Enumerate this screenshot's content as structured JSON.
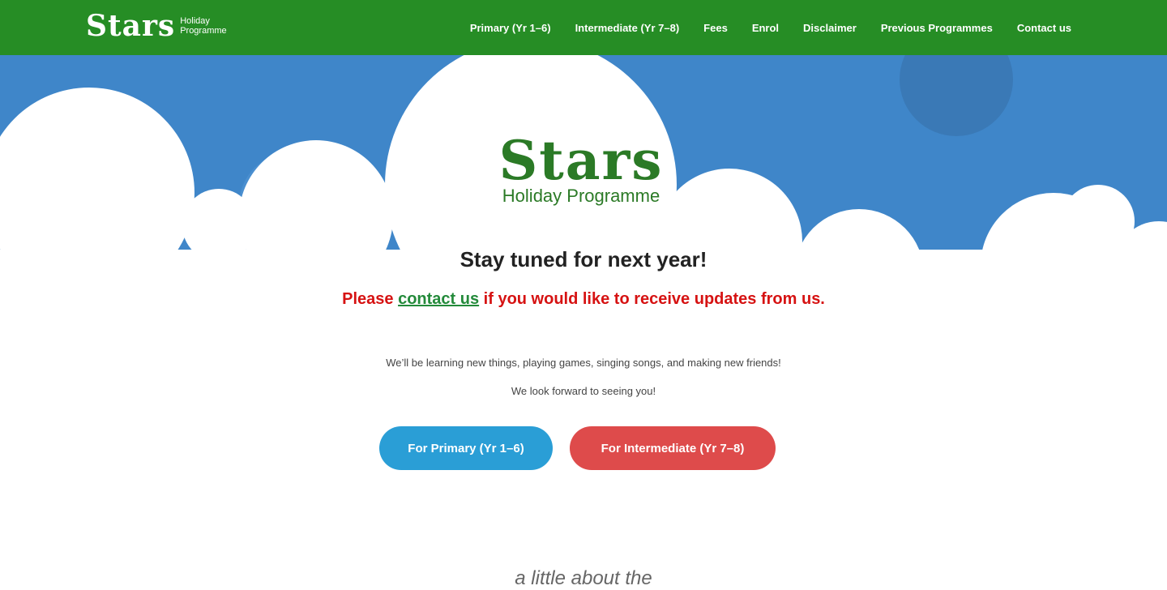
{
  "header": {
    "logo_text": "Stars",
    "logo_sub_line1": "Holiday",
    "logo_sub_line2": "Programme",
    "nav": [
      "Primary (Yr 1–6)",
      "Intermediate (Yr 7–8)",
      "Fees",
      "Enrol",
      "Disclaimer",
      "Previous Programmes",
      "Contact us"
    ]
  },
  "hero": {
    "logo_text": "Stars",
    "logo_sub": "Holiday Programme",
    "headline": "Stay tuned for next year!",
    "notice_prefix": "Please ",
    "notice_link": "contact us",
    "notice_suffix": " if you would like to receive updates from us.",
    "para1": "We’ll be learning new things, playing games, singing songs, and making new friends!",
    "para2": "We look forward to seeing you!",
    "button_primary": "For Primary (Yr 1–6)",
    "button_intermediate": "For Intermediate (Yr 7–8)"
  },
  "section": {
    "heading_partial": "a little about the"
  },
  "colors": {
    "header_green": "#268d25",
    "sky_blue": "#3f86c9",
    "brand_green": "#2b7a26",
    "primary_button": "#2a9ed6",
    "intermediate_button": "#de4b4b",
    "notice_red": "#d61212",
    "link_green": "#238a3a"
  }
}
